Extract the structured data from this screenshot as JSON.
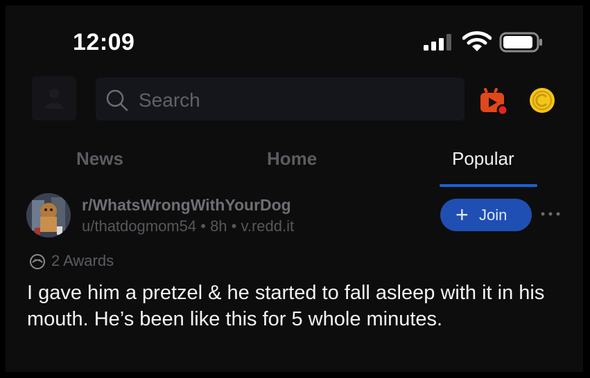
{
  "status_bar": {
    "time": "12:09"
  },
  "header": {
    "search_placeholder": "Search"
  },
  "tabs": [
    {
      "label": "News"
    },
    {
      "label": "Home"
    },
    {
      "label": "Popular",
      "active": true
    }
  ],
  "post": {
    "subreddit": "r/WhatsWrongWithYourDog",
    "user": "u/thatdogmom54",
    "age": "8h",
    "domain": "v.redd.it",
    "separator": "•",
    "join_label": "Join",
    "join_plus": "+",
    "awards": "2 Awards",
    "title": "I gave him a pretzel & he started to fall asleep with it in his mouth. He’s been like this for 5 whole minutes."
  },
  "colors": {
    "accent": "#1f4fb3",
    "tab_underline": "#1a62d6",
    "background": "#0d0d0d",
    "live_icon": "#e0481a",
    "coin": "#f5c518"
  }
}
